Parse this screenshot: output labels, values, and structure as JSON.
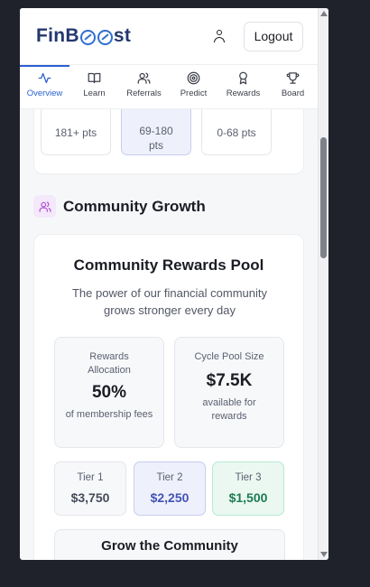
{
  "header": {
    "logo_text": "FinB",
    "logo_suffix": "st",
    "logout_label": "Logout"
  },
  "nav": {
    "items": [
      {
        "label": "Overview",
        "active": true
      },
      {
        "label": "Learn"
      },
      {
        "label": "Referrals"
      },
      {
        "label": "Predict"
      },
      {
        "label": "Rewards"
      },
      {
        "label": "Board"
      }
    ]
  },
  "tiers_top": [
    {
      "range": "181+ pts"
    },
    {
      "range": "69-180 pts"
    },
    {
      "range": "0-68 pts"
    }
  ],
  "section": {
    "title": "Community Growth"
  },
  "pool": {
    "title": "Community Rewards Pool",
    "subtitle": "The power of our financial community grows stronger every day",
    "allocation": {
      "label": "Rewards Allocation",
      "value": "50%",
      "desc": "of membership fees"
    },
    "cycle": {
      "label": "Cycle Pool Size",
      "value": "$7.5K",
      "desc": "available for rewards"
    },
    "tiers": [
      {
        "name": "Tier 1",
        "amount": "$3,750"
      },
      {
        "name": "Tier 2",
        "amount": "$2,250"
      },
      {
        "name": "Tier 3",
        "amount": "$1,500"
      }
    ],
    "grow_title": "Grow the Community"
  },
  "colors": {
    "accent": "#2b5fd0",
    "brand": "#23376e",
    "tier2": "#4453b4",
    "tier3": "#1d7a52"
  }
}
